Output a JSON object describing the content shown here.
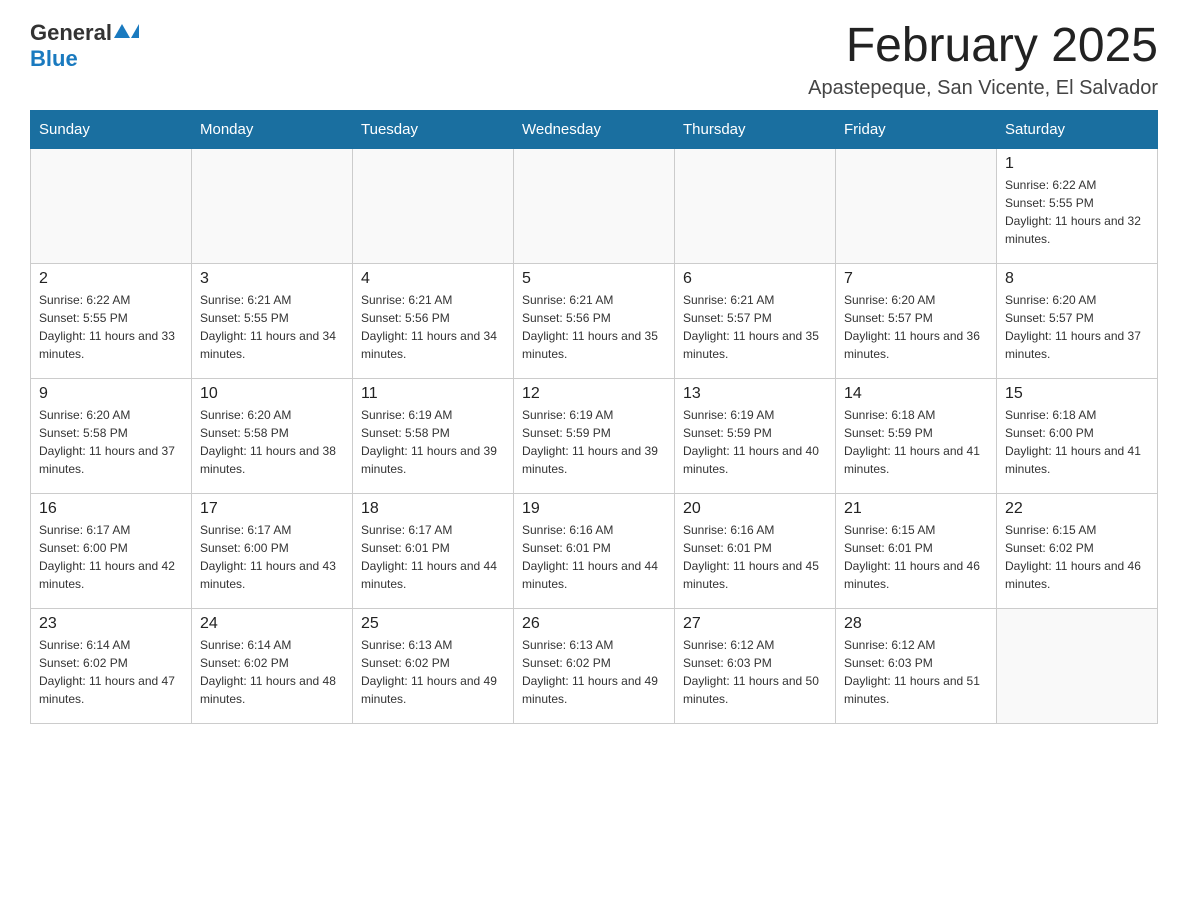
{
  "header": {
    "logo_general": "General",
    "logo_blue": "Blue",
    "month_title": "February 2025",
    "location": "Apastepeque, San Vicente, El Salvador"
  },
  "days_of_week": [
    "Sunday",
    "Monday",
    "Tuesday",
    "Wednesday",
    "Thursday",
    "Friday",
    "Saturday"
  ],
  "weeks": [
    [
      {
        "day": "",
        "info": ""
      },
      {
        "day": "",
        "info": ""
      },
      {
        "day": "",
        "info": ""
      },
      {
        "day": "",
        "info": ""
      },
      {
        "day": "",
        "info": ""
      },
      {
        "day": "",
        "info": ""
      },
      {
        "day": "1",
        "info": "Sunrise: 6:22 AM\nSunset: 5:55 PM\nDaylight: 11 hours and 32 minutes."
      }
    ],
    [
      {
        "day": "2",
        "info": "Sunrise: 6:22 AM\nSunset: 5:55 PM\nDaylight: 11 hours and 33 minutes."
      },
      {
        "day": "3",
        "info": "Sunrise: 6:21 AM\nSunset: 5:55 PM\nDaylight: 11 hours and 34 minutes."
      },
      {
        "day": "4",
        "info": "Sunrise: 6:21 AM\nSunset: 5:56 PM\nDaylight: 11 hours and 34 minutes."
      },
      {
        "day": "5",
        "info": "Sunrise: 6:21 AM\nSunset: 5:56 PM\nDaylight: 11 hours and 35 minutes."
      },
      {
        "day": "6",
        "info": "Sunrise: 6:21 AM\nSunset: 5:57 PM\nDaylight: 11 hours and 35 minutes."
      },
      {
        "day": "7",
        "info": "Sunrise: 6:20 AM\nSunset: 5:57 PM\nDaylight: 11 hours and 36 minutes."
      },
      {
        "day": "8",
        "info": "Sunrise: 6:20 AM\nSunset: 5:57 PM\nDaylight: 11 hours and 37 minutes."
      }
    ],
    [
      {
        "day": "9",
        "info": "Sunrise: 6:20 AM\nSunset: 5:58 PM\nDaylight: 11 hours and 37 minutes."
      },
      {
        "day": "10",
        "info": "Sunrise: 6:20 AM\nSunset: 5:58 PM\nDaylight: 11 hours and 38 minutes."
      },
      {
        "day": "11",
        "info": "Sunrise: 6:19 AM\nSunset: 5:58 PM\nDaylight: 11 hours and 39 minutes."
      },
      {
        "day": "12",
        "info": "Sunrise: 6:19 AM\nSunset: 5:59 PM\nDaylight: 11 hours and 39 minutes."
      },
      {
        "day": "13",
        "info": "Sunrise: 6:19 AM\nSunset: 5:59 PM\nDaylight: 11 hours and 40 minutes."
      },
      {
        "day": "14",
        "info": "Sunrise: 6:18 AM\nSunset: 5:59 PM\nDaylight: 11 hours and 41 minutes."
      },
      {
        "day": "15",
        "info": "Sunrise: 6:18 AM\nSunset: 6:00 PM\nDaylight: 11 hours and 41 minutes."
      }
    ],
    [
      {
        "day": "16",
        "info": "Sunrise: 6:17 AM\nSunset: 6:00 PM\nDaylight: 11 hours and 42 minutes."
      },
      {
        "day": "17",
        "info": "Sunrise: 6:17 AM\nSunset: 6:00 PM\nDaylight: 11 hours and 43 minutes."
      },
      {
        "day": "18",
        "info": "Sunrise: 6:17 AM\nSunset: 6:01 PM\nDaylight: 11 hours and 44 minutes."
      },
      {
        "day": "19",
        "info": "Sunrise: 6:16 AM\nSunset: 6:01 PM\nDaylight: 11 hours and 44 minutes."
      },
      {
        "day": "20",
        "info": "Sunrise: 6:16 AM\nSunset: 6:01 PM\nDaylight: 11 hours and 45 minutes."
      },
      {
        "day": "21",
        "info": "Sunrise: 6:15 AM\nSunset: 6:01 PM\nDaylight: 11 hours and 46 minutes."
      },
      {
        "day": "22",
        "info": "Sunrise: 6:15 AM\nSunset: 6:02 PM\nDaylight: 11 hours and 46 minutes."
      }
    ],
    [
      {
        "day": "23",
        "info": "Sunrise: 6:14 AM\nSunset: 6:02 PM\nDaylight: 11 hours and 47 minutes."
      },
      {
        "day": "24",
        "info": "Sunrise: 6:14 AM\nSunset: 6:02 PM\nDaylight: 11 hours and 48 minutes."
      },
      {
        "day": "25",
        "info": "Sunrise: 6:13 AM\nSunset: 6:02 PM\nDaylight: 11 hours and 49 minutes."
      },
      {
        "day": "26",
        "info": "Sunrise: 6:13 AM\nSunset: 6:02 PM\nDaylight: 11 hours and 49 minutes."
      },
      {
        "day": "27",
        "info": "Sunrise: 6:12 AM\nSunset: 6:03 PM\nDaylight: 11 hours and 50 minutes."
      },
      {
        "day": "28",
        "info": "Sunrise: 6:12 AM\nSunset: 6:03 PM\nDaylight: 11 hours and 51 minutes."
      },
      {
        "day": "",
        "info": ""
      }
    ]
  ]
}
